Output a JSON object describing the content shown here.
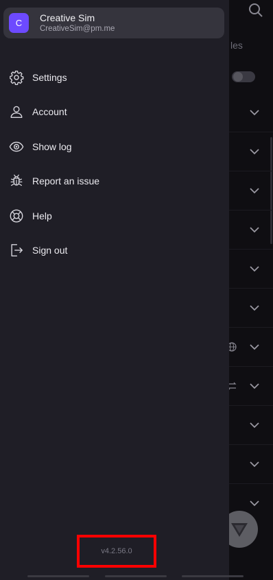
{
  "account": {
    "avatar_initial": "C",
    "name": "Creative Sim",
    "email": "CreativeSim@pm.me"
  },
  "menu": [
    {
      "label": "Settings",
      "icon": "gear-icon"
    },
    {
      "label": "Account",
      "icon": "person-icon"
    },
    {
      "label": "Show log",
      "icon": "eye-icon"
    },
    {
      "label": "Report an issue",
      "icon": "bug-icon"
    },
    {
      "label": "Help",
      "icon": "lifebuoy-icon"
    },
    {
      "label": "Sign out",
      "icon": "sign-out-icon"
    }
  ],
  "version": "v4.2.56.0",
  "background": {
    "partial_text": "les"
  },
  "colors": {
    "drawer_bg": "#1f1e26",
    "card_bg": "#35343d",
    "avatar_bg": "#6d4aff",
    "highlight_box": "#ff0000"
  }
}
